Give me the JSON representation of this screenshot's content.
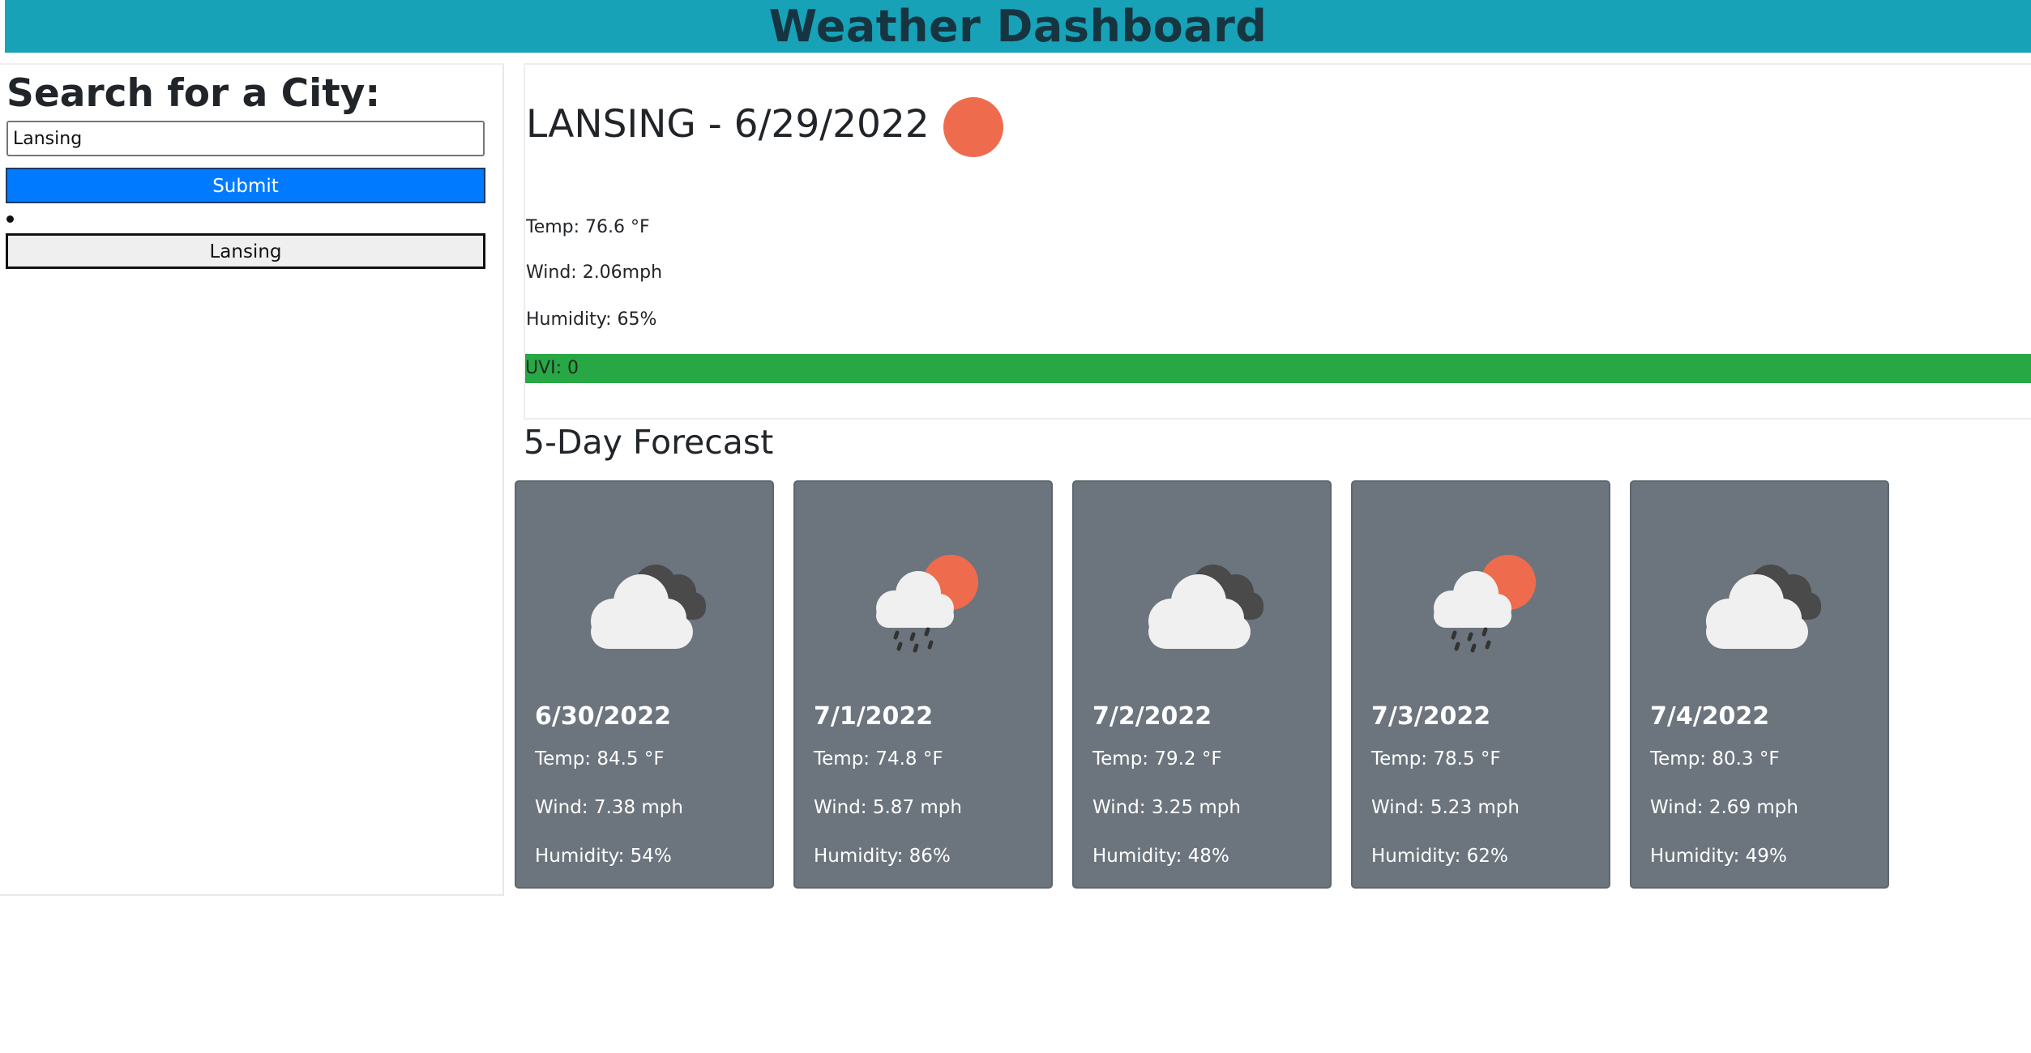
{
  "header": {
    "title": "Weather Dashboard"
  },
  "sidebar": {
    "heading": "Search for a City:",
    "search_value": "Lansing",
    "submit_label": "Submit",
    "history": [
      "Lansing"
    ]
  },
  "current": {
    "title": "LANSING - 6/29/2022",
    "icon": "clear-sky-sun-icon",
    "temp": "Temp: 76.6 °F",
    "wind": "Wind: 2.06mph",
    "humidity": "Humidity: 65%",
    "uvi": "UVI: 0",
    "uvi_color": "#28a745"
  },
  "forecast": {
    "title": "5-Day Forecast",
    "days": [
      {
        "date": "6/30/2022",
        "icon": "broken-clouds-icon",
        "temp": "Temp: 84.5 °F",
        "wind": "Wind: 7.38 mph",
        "humidity": "Humidity: 54%"
      },
      {
        "date": "7/1/2022",
        "icon": "rain-sun-icon",
        "temp": "Temp: 74.8 °F",
        "wind": "Wind: 5.87 mph",
        "humidity": "Humidity: 86%"
      },
      {
        "date": "7/2/2022",
        "icon": "broken-clouds-icon",
        "temp": "Temp: 79.2 °F",
        "wind": "Wind: 3.25 mph",
        "humidity": "Humidity: 48%"
      },
      {
        "date": "7/3/2022",
        "icon": "rain-sun-icon",
        "temp": "Temp: 78.5 °F",
        "wind": "Wind: 5.23 mph",
        "humidity": "Humidity: 62%"
      },
      {
        "date": "7/4/2022",
        "icon": "broken-clouds-icon",
        "temp": "Temp: 80.3 °F",
        "wind": "Wind: 2.69 mph",
        "humidity": "Humidity: 49%"
      }
    ]
  },
  "colors": {
    "header_bg": "#17a2b8",
    "submit_bg": "#007bff",
    "card_bg": "#6c757d",
    "sun": "#ee6c4d"
  }
}
